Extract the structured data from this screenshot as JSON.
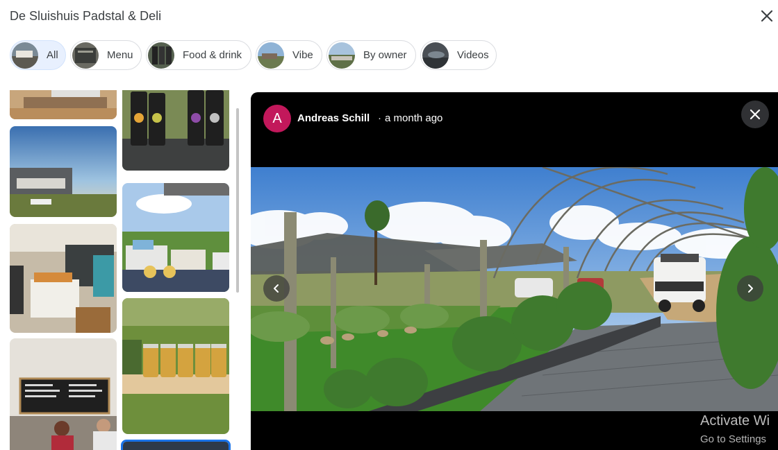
{
  "header": {
    "title": "De Sluishuis Padstal & Deli"
  },
  "chips": [
    {
      "label": "All",
      "active": true
    },
    {
      "label": "Menu",
      "active": false
    },
    {
      "label": "Food & drink",
      "active": false
    },
    {
      "label": "Vibe",
      "active": false
    },
    {
      "label": "By owner",
      "active": false
    },
    {
      "label": "Videos",
      "active": false
    }
  ],
  "viewer": {
    "avatar_letter": "A",
    "author": "Andreas Schill",
    "separator": "·",
    "time": "a month ago"
  },
  "watermark": {
    "line1": "Activate Wi",
    "line2": "Go to Settings"
  },
  "colors": {
    "avatar": "#c2185b",
    "chip_active_bg": "#e8f0fe",
    "viewer_bg": "#000000"
  },
  "icons": [
    "close-icon",
    "chevron-left-icon",
    "chevron-right-icon"
  ]
}
